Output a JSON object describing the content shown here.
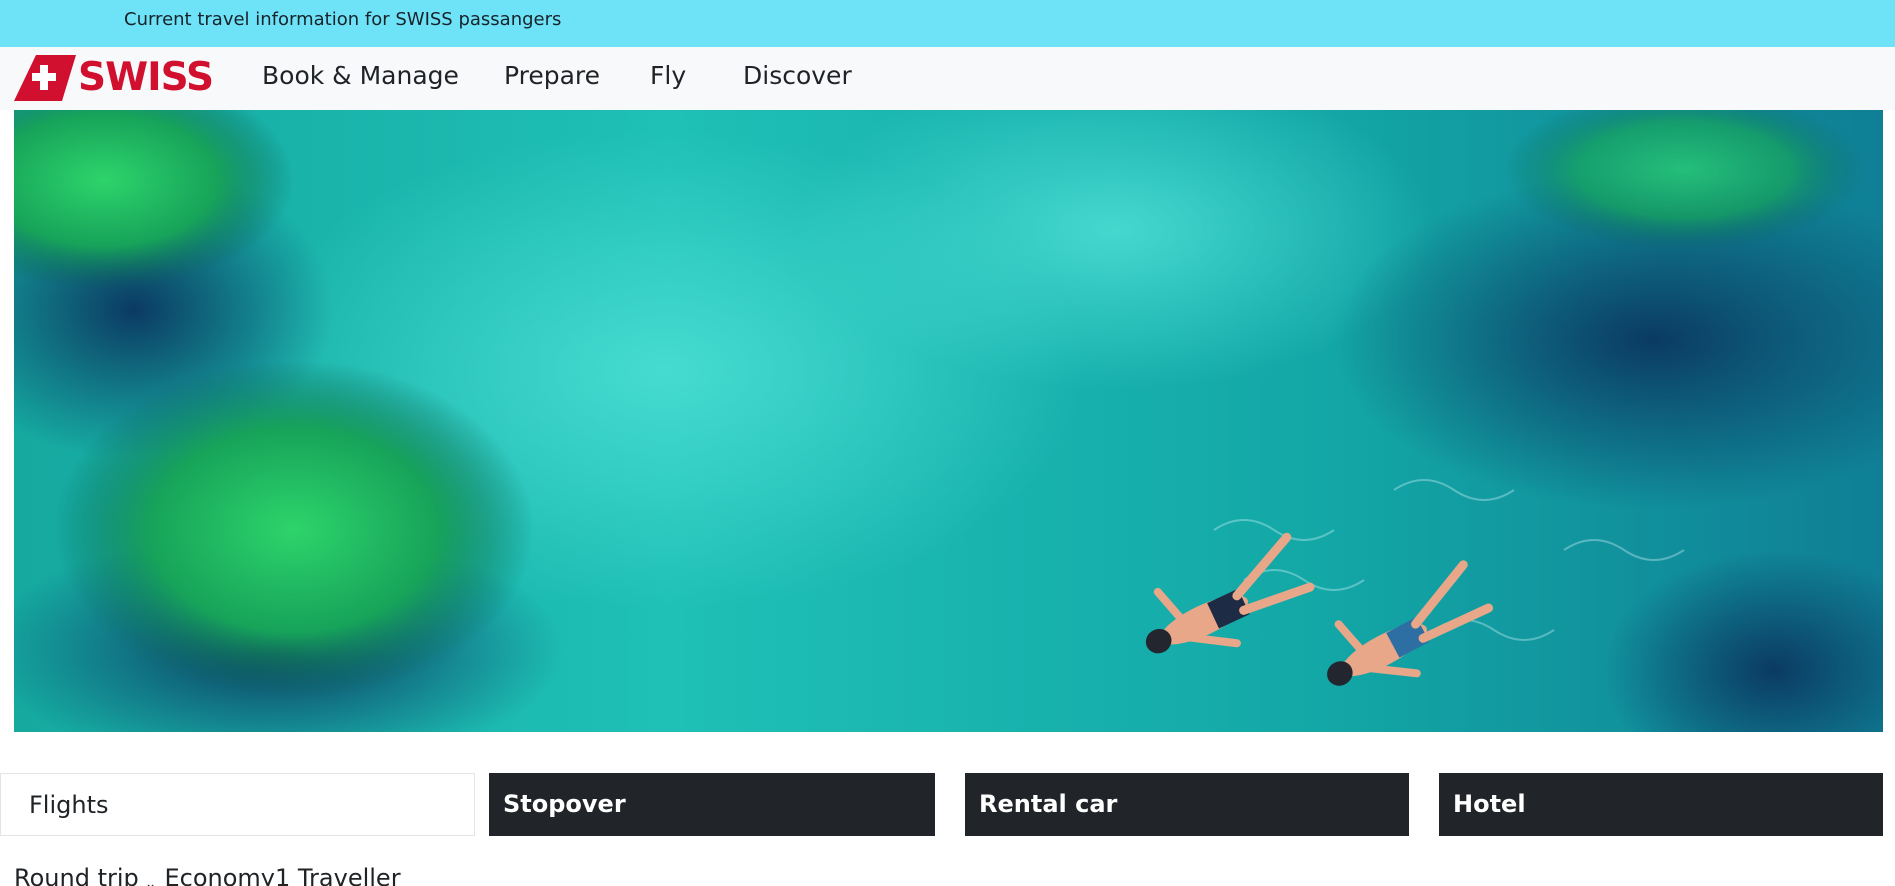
{
  "topbar": {
    "notice_link": "Current travel information for SWISS passangers"
  },
  "header": {
    "logo_text": "SWISS",
    "nav": [
      {
        "label": "Book & Manage"
      },
      {
        "label": "Prepare"
      },
      {
        "label": "Fly"
      },
      {
        "label": "Discover"
      }
    ]
  },
  "hero": {
    "icon": "aerial-snorkelers-image"
  },
  "booking_tabs": [
    {
      "label": "Flights",
      "active": true
    },
    {
      "label": "Stopover",
      "active": false
    },
    {
      "label": "Rental car",
      "active": false
    },
    {
      "label": "Hotel",
      "active": false
    }
  ],
  "booking_options": {
    "trip_type": "Round trip",
    "cabin_class": "Economy",
    "travellers": "1 Traveller"
  },
  "colors": {
    "brand_red": "#d0102e",
    "info_bar": "#6ee2f6",
    "dark_tab": "#212429"
  }
}
